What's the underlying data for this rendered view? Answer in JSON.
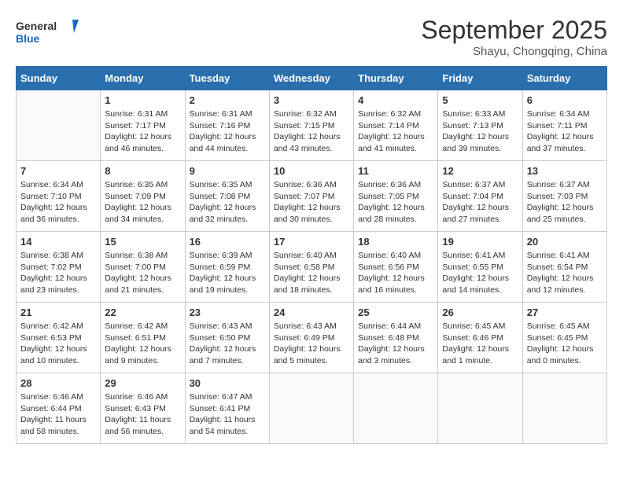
{
  "header": {
    "logo_line1": "General",
    "logo_line2": "Blue",
    "month": "September 2025",
    "location": "Shayu, Chongqing, China"
  },
  "days_of_week": [
    "Sunday",
    "Monday",
    "Tuesday",
    "Wednesday",
    "Thursday",
    "Friday",
    "Saturday"
  ],
  "weeks": [
    [
      {
        "day": "",
        "detail": ""
      },
      {
        "day": "1",
        "detail": "Sunrise: 6:31 AM\nSunset: 7:17 PM\nDaylight: 12 hours\nand 46 minutes."
      },
      {
        "day": "2",
        "detail": "Sunrise: 6:31 AM\nSunset: 7:16 PM\nDaylight: 12 hours\nand 44 minutes."
      },
      {
        "day": "3",
        "detail": "Sunrise: 6:32 AM\nSunset: 7:15 PM\nDaylight: 12 hours\nand 43 minutes."
      },
      {
        "day": "4",
        "detail": "Sunrise: 6:32 AM\nSunset: 7:14 PM\nDaylight: 12 hours\nand 41 minutes."
      },
      {
        "day": "5",
        "detail": "Sunrise: 6:33 AM\nSunset: 7:13 PM\nDaylight: 12 hours\nand 39 minutes."
      },
      {
        "day": "6",
        "detail": "Sunrise: 6:34 AM\nSunset: 7:11 PM\nDaylight: 12 hours\nand 37 minutes."
      }
    ],
    [
      {
        "day": "7",
        "detail": "Sunrise: 6:34 AM\nSunset: 7:10 PM\nDaylight: 12 hours\nand 36 minutes."
      },
      {
        "day": "8",
        "detail": "Sunrise: 6:35 AM\nSunset: 7:09 PM\nDaylight: 12 hours\nand 34 minutes."
      },
      {
        "day": "9",
        "detail": "Sunrise: 6:35 AM\nSunset: 7:08 PM\nDaylight: 12 hours\nand 32 minutes."
      },
      {
        "day": "10",
        "detail": "Sunrise: 6:36 AM\nSunset: 7:07 PM\nDaylight: 12 hours\nand 30 minutes."
      },
      {
        "day": "11",
        "detail": "Sunrise: 6:36 AM\nSunset: 7:05 PM\nDaylight: 12 hours\nand 28 minutes."
      },
      {
        "day": "12",
        "detail": "Sunrise: 6:37 AM\nSunset: 7:04 PM\nDaylight: 12 hours\nand 27 minutes."
      },
      {
        "day": "13",
        "detail": "Sunrise: 6:37 AM\nSunset: 7:03 PM\nDaylight: 12 hours\nand 25 minutes."
      }
    ],
    [
      {
        "day": "14",
        "detail": "Sunrise: 6:38 AM\nSunset: 7:02 PM\nDaylight: 12 hours\nand 23 minutes."
      },
      {
        "day": "15",
        "detail": "Sunrise: 6:38 AM\nSunset: 7:00 PM\nDaylight: 12 hours\nand 21 minutes."
      },
      {
        "day": "16",
        "detail": "Sunrise: 6:39 AM\nSunset: 6:59 PM\nDaylight: 12 hours\nand 19 minutes."
      },
      {
        "day": "17",
        "detail": "Sunrise: 6:40 AM\nSunset: 6:58 PM\nDaylight: 12 hours\nand 18 minutes."
      },
      {
        "day": "18",
        "detail": "Sunrise: 6:40 AM\nSunset: 6:56 PM\nDaylight: 12 hours\nand 16 minutes."
      },
      {
        "day": "19",
        "detail": "Sunrise: 6:41 AM\nSunset: 6:55 PM\nDaylight: 12 hours\nand 14 minutes."
      },
      {
        "day": "20",
        "detail": "Sunrise: 6:41 AM\nSunset: 6:54 PM\nDaylight: 12 hours\nand 12 minutes."
      }
    ],
    [
      {
        "day": "21",
        "detail": "Sunrise: 6:42 AM\nSunset: 6:53 PM\nDaylight: 12 hours\nand 10 minutes."
      },
      {
        "day": "22",
        "detail": "Sunrise: 6:42 AM\nSunset: 6:51 PM\nDaylight: 12 hours\nand 9 minutes."
      },
      {
        "day": "23",
        "detail": "Sunrise: 6:43 AM\nSunset: 6:50 PM\nDaylight: 12 hours\nand 7 minutes."
      },
      {
        "day": "24",
        "detail": "Sunrise: 6:43 AM\nSunset: 6:49 PM\nDaylight: 12 hours\nand 5 minutes."
      },
      {
        "day": "25",
        "detail": "Sunrise: 6:44 AM\nSunset: 6:48 PM\nDaylight: 12 hours\nand 3 minutes."
      },
      {
        "day": "26",
        "detail": "Sunrise: 6:45 AM\nSunset: 6:46 PM\nDaylight: 12 hours\nand 1 minute."
      },
      {
        "day": "27",
        "detail": "Sunrise: 6:45 AM\nSunset: 6:45 PM\nDaylight: 12 hours\nand 0 minutes."
      }
    ],
    [
      {
        "day": "28",
        "detail": "Sunrise: 6:46 AM\nSunset: 6:44 PM\nDaylight: 11 hours\nand 58 minutes."
      },
      {
        "day": "29",
        "detail": "Sunrise: 6:46 AM\nSunset: 6:43 PM\nDaylight: 11 hours\nand 56 minutes."
      },
      {
        "day": "30",
        "detail": "Sunrise: 6:47 AM\nSunset: 6:41 PM\nDaylight: 11 hours\nand 54 minutes."
      },
      {
        "day": "",
        "detail": ""
      },
      {
        "day": "",
        "detail": ""
      },
      {
        "day": "",
        "detail": ""
      },
      {
        "day": "",
        "detail": ""
      }
    ]
  ]
}
